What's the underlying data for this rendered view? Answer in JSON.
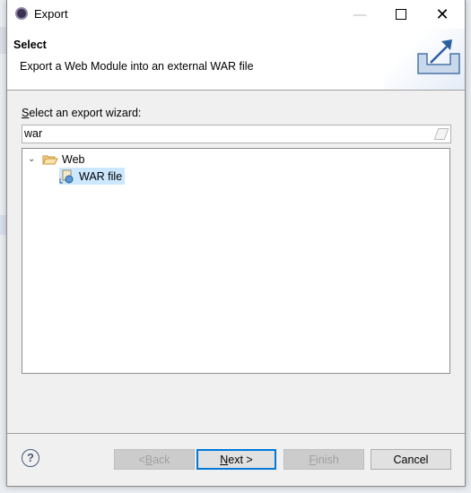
{
  "window": {
    "title": "Export",
    "minimize_icon": "minimize-icon",
    "maximize_icon": "maximize-icon",
    "close_icon": "close-icon"
  },
  "header": {
    "title": "Select",
    "description": "Export a Web Module into an external WAR file",
    "banner_icon": "export-icon"
  },
  "wizard": {
    "label_prefix": "S",
    "label_rest": "elect an export wizard:",
    "filter_value": "war"
  },
  "tree": {
    "items": [
      {
        "label": "Web",
        "expanded": true,
        "icon": "folder-open-icon"
      },
      {
        "label": "WAR file",
        "selected": true,
        "icon": "war-file-icon"
      }
    ]
  },
  "buttons": {
    "back_prefix": "< ",
    "back_mn": "B",
    "back_rest": "ack",
    "next_mn": "N",
    "next_rest": "ext >",
    "finish_mn": "F",
    "finish_rest": "inish",
    "cancel": "Cancel"
  },
  "colors": {
    "accent": "#0078d7",
    "selection": "#cce8ff"
  }
}
